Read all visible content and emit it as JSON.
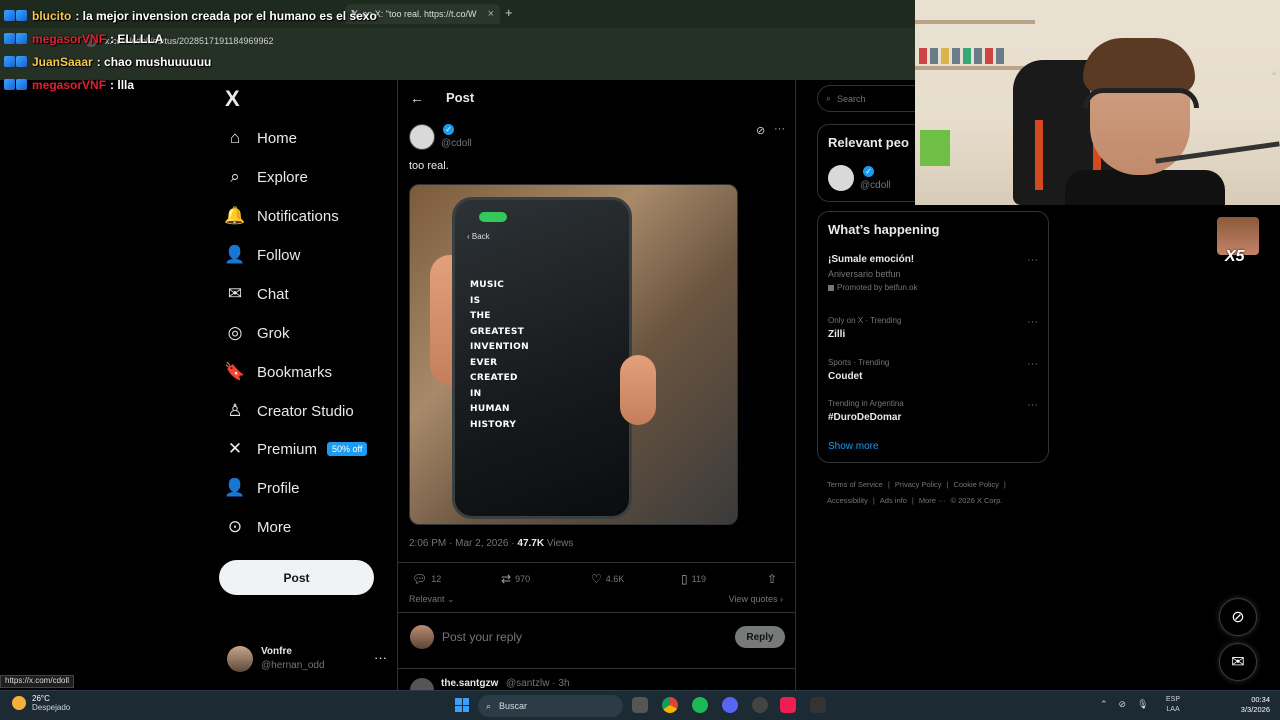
{
  "browser": {
    "tab_title": "on X: \"too real. https://t.co/W",
    "address": "x.com/cdoll/status/2028517191184969962",
    "new_tab": "+",
    "close": "×"
  },
  "chat": [
    {
      "user": "blucito",
      "user_color": "#f2c94c",
      "msg": "la mejor invension creada por el humano es el sexo"
    },
    {
      "user": "megasorVNF",
      "user_color": "#e0202f",
      "msg": "ELLLLA"
    },
    {
      "user": "JuanSaaar",
      "user_color": "#f2c94c",
      "msg": "chao mushuuuuuu"
    },
    {
      "user": "megasorVNF",
      "user_color": "#e0202f",
      "msg": "llla"
    }
  ],
  "nav": {
    "logo": "X",
    "items": [
      {
        "label": "Home",
        "icon": "home-icon",
        "glyph": "⌂"
      },
      {
        "label": "Explore",
        "icon": "search-icon",
        "glyph": "⌕"
      },
      {
        "label": "Notifications",
        "icon": "bell-icon",
        "glyph": "🔔"
      },
      {
        "label": "Follow",
        "icon": "follow-icon",
        "glyph": "👤"
      },
      {
        "label": "Chat",
        "icon": "mail-icon",
        "glyph": "✉"
      },
      {
        "label": "Grok",
        "icon": "grok-icon",
        "glyph": "◎"
      },
      {
        "label": "Bookmarks",
        "icon": "bookmark-icon",
        "glyph": "🔖"
      },
      {
        "label": "Creator Studio",
        "icon": "creator-studio-icon",
        "glyph": "♙"
      },
      {
        "label": "Premium",
        "icon": "x-premium-icon",
        "glyph": "✕"
      },
      {
        "label": "Profile",
        "icon": "profile-icon",
        "glyph": "👤"
      },
      {
        "label": "More",
        "icon": "more-circle-icon",
        "glyph": "⊙"
      }
    ],
    "premium_badge": "50% off",
    "post_button": "Post",
    "account": {
      "name": "Vonfre",
      "handle": "@hernan_odd",
      "more": "···"
    }
  },
  "post": {
    "header_title": "Post",
    "back": "←",
    "handle": "@cdoll",
    "text": "too real.",
    "image_text": "MUSIC\nIS\nTHE\nGREATEST\nINVENTION\nEVER\nCREATED\nIN\nHUMAN\nHISTORY",
    "phone_back": "‹ Back",
    "meta_time": "2:06 PM · Mar 2, 2026 · ",
    "meta_views_count": "47.7K",
    "meta_views_label": " Views",
    "stats": {
      "replies": "12",
      "reposts": "970",
      "likes": "4.6K",
      "bookmarks": "119"
    },
    "sort_label": "Relevant",
    "view_quotes": "View quotes ›",
    "reply_placeholder": "Post your reply",
    "reply_button": "Reply",
    "next_reply": {
      "name": "the.santgzw",
      "handle": "@santzlw · 3h"
    }
  },
  "right": {
    "search_placeholder": "Search",
    "relevant_title": "Relevant peo",
    "relevant_handle": "@cdoll",
    "happening_title": "What’s happening",
    "trends": [
      {
        "meta": "",
        "name": "¡Sumale emoción!",
        "sub": "Aniversario betfun",
        "promo": "Promoted by betfun.ok"
      },
      {
        "meta": "Only on X · Trending",
        "name": "Zilli",
        "sub": "",
        "promo": ""
      },
      {
        "meta": "Sports · Trending",
        "name": "Coudet",
        "sub": "",
        "promo": ""
      },
      {
        "meta": "Trending in Argentina",
        "name": "#DuroDeDomar",
        "sub": "",
        "promo": ""
      }
    ],
    "show_more": "Show more",
    "footer": [
      "Terms of Service",
      "|",
      "Privacy Policy",
      "|",
      "Cookie Policy",
      "|",
      "Accessibility",
      "|",
      "Ads info",
      "|",
      "More ···",
      "© 2026 X Corp."
    ]
  },
  "overlay": {
    "emote_text": "X5"
  },
  "status_url": "https://x.com/cdoll",
  "taskbar": {
    "temp": "26°C",
    "weather": "Despejado",
    "search": "Buscar",
    "lang_1": "ESP",
    "lang_2": "LAA",
    "time": "00:34",
    "date": "3/3/2026"
  },
  "colors": {
    "accent": "#1d9bf0",
    "background": "#000000",
    "text": "#e7e9ea",
    "muted": "#71767b"
  }
}
